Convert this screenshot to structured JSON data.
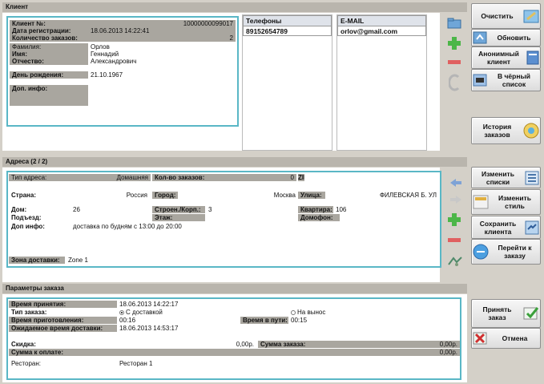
{
  "client": {
    "header": "Клиент",
    "fields": [
      {
        "label": "Клиент №:",
        "value": "",
        "right": "10000000099017",
        "gray": false
      },
      {
        "label": "Дата регистрации:",
        "value": "18.06.2013 14:22:41",
        "right": "",
        "gray": false
      },
      {
        "label": "Количество заказов:",
        "value": "",
        "right": "2",
        "gray": false
      },
      {
        "label": "Фамилия:",
        "value": "Орлов",
        "right": "",
        "gray": true
      },
      {
        "label": "Имя:",
        "value": "Геннадий",
        "right": "",
        "gray": true
      },
      {
        "label": "Отчество:",
        "value": "Александрович",
        "right": "",
        "gray": true
      },
      {
        "label": "День рождения:",
        "value": "21.10.1967",
        "right": "",
        "gray": true
      },
      {
        "label": "Доп. инфо:",
        "value": "",
        "right": "",
        "gray": true
      }
    ],
    "phones_header": "Телефоны",
    "phones": [
      "89152654789"
    ],
    "email_header": "E-MAIL",
    "emails": [
      "orlov@gmail.com"
    ]
  },
  "addresses": {
    "header": "Адреса  (2 / 2)",
    "type_label": "Тип адреса:",
    "type_value": "Домашняя",
    "orders_label": "Кол-во заказов:",
    "orders_value": "0",
    "zip_label": "ZIP:",
    "country_label": "Страна:",
    "country_value": "Россия",
    "city_label": "Город:",
    "city_value": "Москва",
    "street_label": "Улица:",
    "street_value": "ФИЛЕВСКАЯ Б. УЛ",
    "house_label": "Дом:",
    "house_value": "26",
    "building_label": "Строен./Корп.:",
    "building_value": "3",
    "apt_label": "Квартира:",
    "apt_value": "106",
    "entrance_label": "Подъезд:",
    "floor_label": "Этаж:",
    "intercom_label": "Домофон:",
    "extra_label": "Доп инфо:",
    "extra_value": "доставка по будням с 13:00 до 20:00",
    "zone_label": "Зона доставки:",
    "zone_value": "Zone 1"
  },
  "order": {
    "header": "Параметры заказа",
    "accepted_label": "Время принятия:",
    "accepted_value": "18.06.2013 14:22:17",
    "type_label": "Тип заказа:",
    "type_delivery": "С доставкой",
    "type_pickup": "На вынос",
    "prep_label": "Время приготовления:",
    "prep_value": "00:16",
    "way_label": "Время в пути:",
    "way_value": "00:15",
    "expected_label": "Ожидаемое время доставки:",
    "expected_value": "18.06.2013 14:53:17",
    "discount_label": "Скидка:",
    "discount_value": "0,00р.",
    "sum_label": "Сумма заказа:",
    "sum_value": "0,00р.",
    "topay_label": "Сумма к оплате:",
    "topay_value": "0,00р.",
    "restaurant_label": "Ресторан:",
    "restaurant_value": "Ресторан 1"
  },
  "buttons": {
    "clear": "Очистить",
    "update": "Обновить",
    "anonymous": "Анонимный\nклиент",
    "blacklist": "В чёрный\nсписок",
    "history": "История\nзаказов",
    "change_lists": "Изменить\nсписки",
    "change_style": "Изменить\nстиль",
    "save_client": "Сохранить\nклиента",
    "goto_order": "Перейти к\nзаказу",
    "accept_order": "Принять\nзаказ",
    "cancel": "Отмена"
  },
  "colors": {
    "accent": "#5ab7c6",
    "panel": "#d4d0c8",
    "label_gray": "#a9a69f",
    "green": "#4cb648",
    "red": "#e06060"
  }
}
